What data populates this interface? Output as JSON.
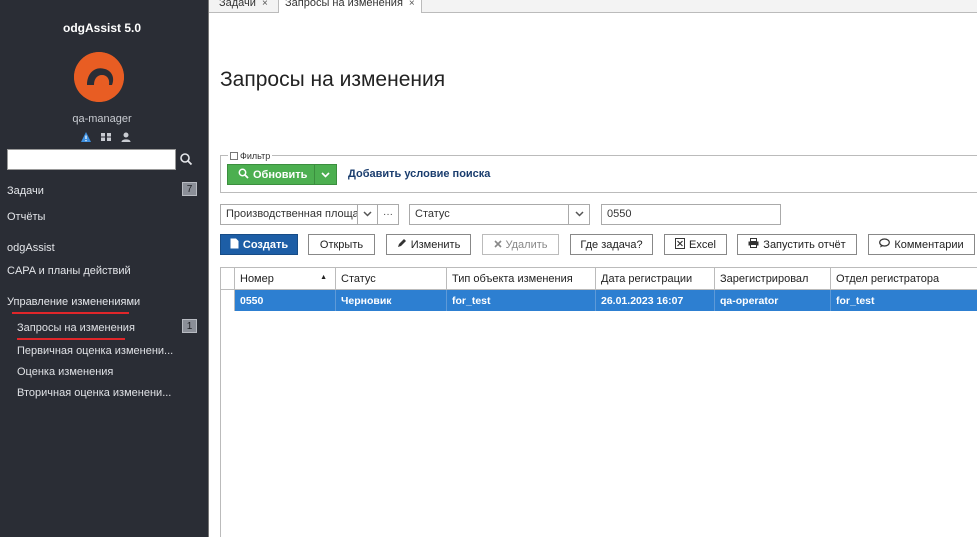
{
  "sidebar": {
    "app_title": "odgAssist 5.0",
    "username": "qa-manager",
    "search_placeholder": "",
    "items": [
      {
        "label": "Задачи",
        "badge": "7"
      },
      {
        "label": "Отчёты"
      },
      {
        "label": "odgAssist"
      },
      {
        "label": "CAPA и планы действий"
      },
      {
        "label": "Управление изменениями"
      },
      {
        "label": "Запросы на изменения",
        "badge": "1"
      },
      {
        "label": "Первичная оценка изменени..."
      },
      {
        "label": "Оценка изменения"
      },
      {
        "label": "Вторичная оценка изменени..."
      }
    ]
  },
  "tabs": [
    {
      "label": "Задачи",
      "close": "×"
    },
    {
      "label": "Запросы на изменения",
      "close": "×"
    }
  ],
  "page": {
    "title": "Запросы на изменения"
  },
  "filter": {
    "legend": "Фильтр",
    "refresh_label": "Обновить",
    "add_condition_label": "Добавить условие поиска",
    "field1_value": "Производственная площа",
    "field1_more": "···",
    "field2_value": "Статус",
    "field3_value": "0550"
  },
  "toolbar": {
    "create": "Создать",
    "open": "Открыть",
    "edit": "Изменить",
    "delete": "Удалить",
    "where_task": "Где задача?",
    "excel": "Excel",
    "run_report": "Запустить отчёт",
    "comments": "Комментарии"
  },
  "table": {
    "columns": [
      "Номер",
      "Статус",
      "Тип объекта изменения",
      "Дата регистрации",
      "Зарегистрировал",
      "Отдел регистратора"
    ],
    "rows": [
      [
        "0550",
        "Черновик",
        "for_test",
        "26.01.2023 16:07",
        "qa-operator",
        "for_test"
      ]
    ]
  },
  "colors": {
    "sidebar_bg": "#2a2d35",
    "accent_orange": "#e85d23",
    "refresh_green": "#4caf50",
    "primary_blue": "#1d5ea6",
    "selected_row": "#2d7fd1",
    "underline_red": "#e0262a"
  }
}
